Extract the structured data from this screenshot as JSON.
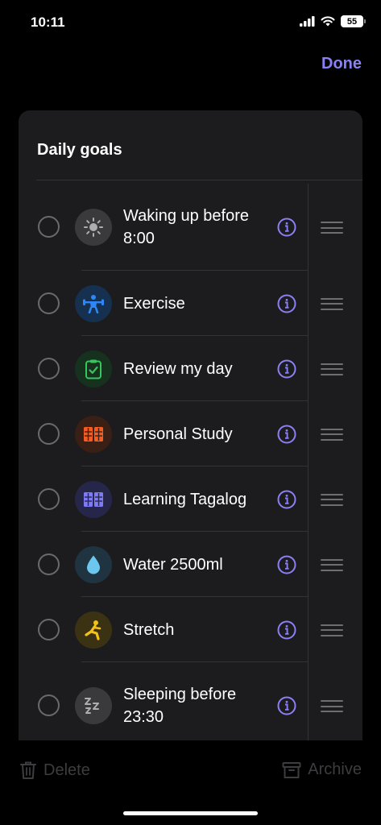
{
  "status_bar": {
    "time": "10:11",
    "battery": "55"
  },
  "header": {
    "done_label": "Done"
  },
  "card": {
    "title": "Daily goals"
  },
  "goals": [
    {
      "label": "Waking up before 8:00",
      "icon": "sun-icon",
      "icon_bg": "#3a3a3c",
      "icon_color": "#aeaeb2"
    },
    {
      "label": "Exercise",
      "icon": "weightlifter-icon",
      "icon_bg": "#16304f",
      "icon_color": "#2f86f5"
    },
    {
      "label": "Review my day",
      "icon": "clipboard-check-icon",
      "icon_bg": "#16321f",
      "icon_color": "#34c759"
    },
    {
      "label": "Personal Study",
      "icon": "book-icon",
      "icon_bg": "#3a1f14",
      "icon_color": "#f45c22"
    },
    {
      "label": "Learning Tagalog",
      "icon": "book-icon",
      "icon_bg": "#26264a",
      "icon_color": "#7f7af5"
    },
    {
      "label": "Water 2500ml",
      "icon": "water-drop-icon",
      "icon_bg": "#1f3440",
      "icon_color": "#6cc7ee"
    },
    {
      "label": "Stretch",
      "icon": "stretch-figure-icon",
      "icon_bg": "#3b3214",
      "icon_color": "#f2c21a"
    },
    {
      "label": "Sleeping before 23:30",
      "icon": "zzz-icon",
      "icon_bg": "#3a3a3c",
      "icon_color": "#aeaeb2"
    }
  ],
  "bottom_bar": {
    "delete_label": "Delete",
    "archive_label": "Archive"
  },
  "colors": {
    "accent": "#8a80f5",
    "background": "#000000",
    "card": "#1c1c1e"
  }
}
